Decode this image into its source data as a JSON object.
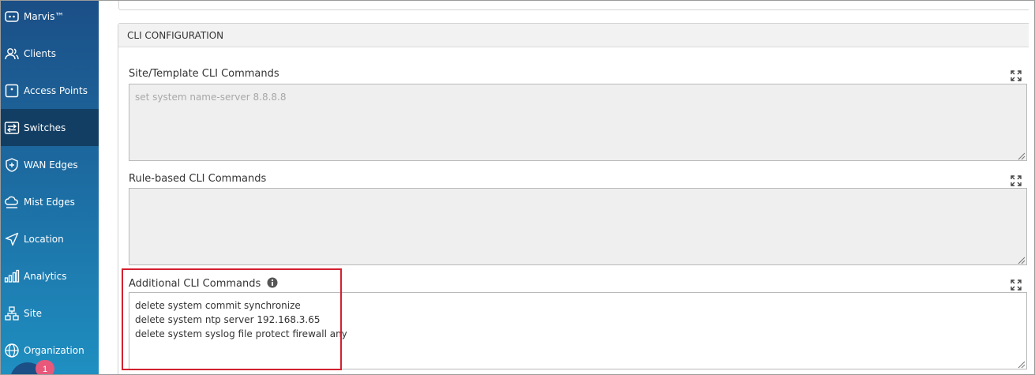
{
  "sidebar": {
    "items": [
      {
        "label": "Marvis™",
        "icon": "marvis-icon"
      },
      {
        "label": "Clients",
        "icon": "clients-icon"
      },
      {
        "label": "Access Points",
        "icon": "access-point-icon"
      },
      {
        "label": "Switches",
        "icon": "switches-icon",
        "active": true
      },
      {
        "label": "WAN Edges",
        "icon": "wan-edges-icon"
      },
      {
        "label": "Mist Edges",
        "icon": "mist-edges-icon"
      },
      {
        "label": "Location",
        "icon": "location-icon"
      },
      {
        "label": "Analytics",
        "icon": "analytics-icon"
      },
      {
        "label": "Site",
        "icon": "site-icon"
      },
      {
        "label": "Organization",
        "icon": "organization-icon"
      }
    ],
    "notification_count": "1"
  },
  "panel": {
    "title": "CLI CONFIGURATION",
    "site_template": {
      "label": "Site/Template CLI Commands",
      "placeholder": "set system name-server 8.8.8.8"
    },
    "rule_based": {
      "label": "Rule-based CLI Commands"
    },
    "additional": {
      "label": "Additional CLI Commands",
      "lines": [
        "delete system commit synchronize",
        "delete system ntp server 192.168.3.65",
        "delete system syslog file protect firewall any"
      ]
    }
  },
  "colors": {
    "sidebar_top": "#1b4f86",
    "sidebar_bottom": "#1f8fc1",
    "active_item": "#123e63",
    "highlight": "#d2202f",
    "badge": "#e8587a"
  }
}
